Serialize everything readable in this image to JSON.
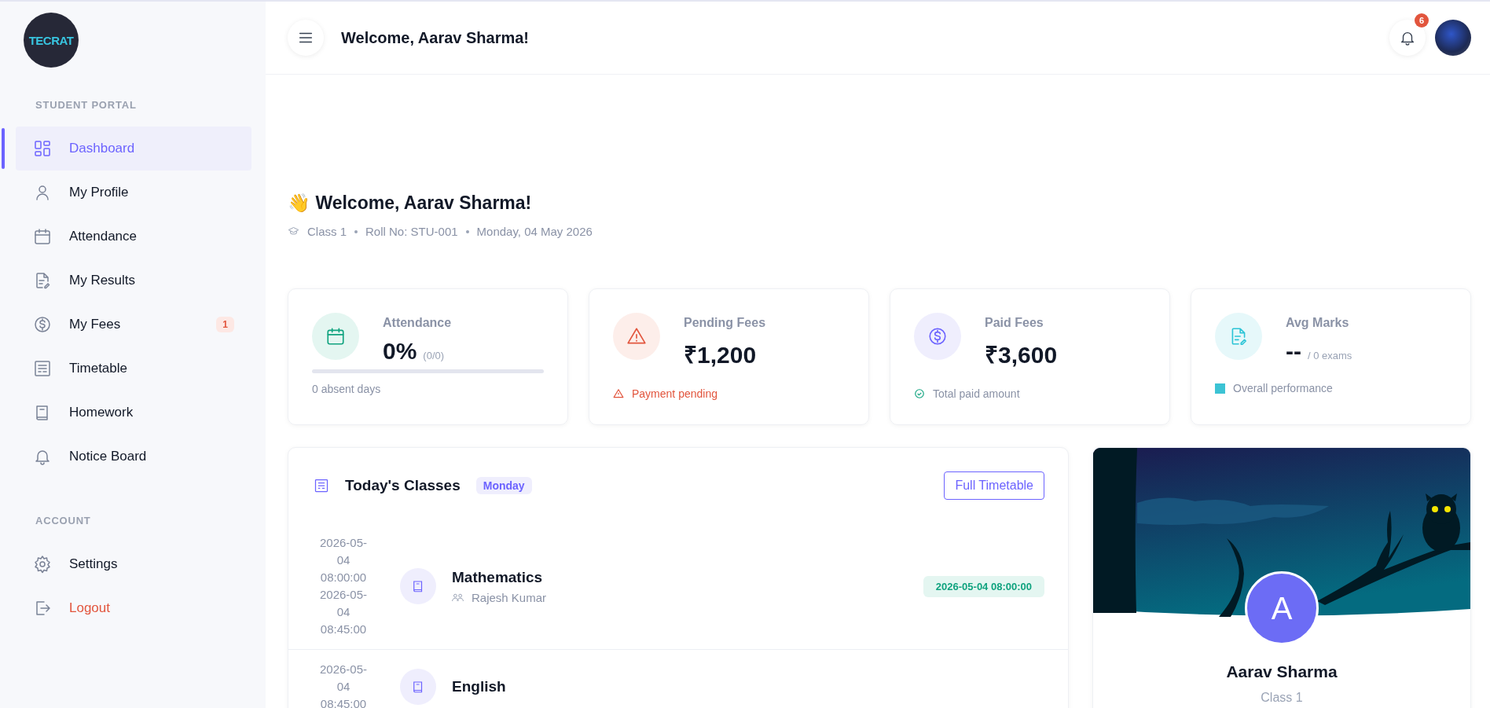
{
  "logo": {
    "text": "TECRAT"
  },
  "sidebar": {
    "sections": [
      {
        "title": "STUDENT PORTAL",
        "items": [
          {
            "label": "Dashboard",
            "kind": "grid",
            "selected": true
          },
          {
            "label": "My Profile",
            "kind": "user",
            "selected": false
          },
          {
            "label": "Attendance",
            "kind": "calendar",
            "selected": false
          },
          {
            "label": "My Results",
            "kind": "doc",
            "selected": false
          },
          {
            "label": "My Fees",
            "kind": "dollar",
            "selected": false,
            "badge": "1"
          },
          {
            "label": "Timetable",
            "kind": "table",
            "selected": false
          },
          {
            "label": "Homework",
            "kind": "book",
            "selected": false
          },
          {
            "label": "Notice Board",
            "kind": "bell",
            "selected": false
          }
        ]
      },
      {
        "title": "ACCOUNT",
        "items": [
          {
            "label": "Settings",
            "kind": "gear",
            "selected": false
          },
          {
            "label": "Logout",
            "kind": "logout",
            "selected": false,
            "danger": true
          }
        ]
      }
    ]
  },
  "header": {
    "title": "Welcome, Aarav Sharma!",
    "notifications": "6"
  },
  "welcome": {
    "emoji": "👋",
    "title": "Welcome, Aarav Sharma!",
    "meta": [
      "Class 1",
      "Roll No: STU-001",
      "Monday, 04 May 2026"
    ]
  },
  "stats": [
    {
      "kind": "attendance",
      "label": "Attendance",
      "value": "0%",
      "sub": "(0/0)",
      "level": 0,
      "footer": "0 absent days"
    },
    {
      "kind": "pending",
      "label": "Pending Fees",
      "value": "₹1,200",
      "footer": "Payment pending"
    },
    {
      "kind": "paid",
      "label": "Paid Fees",
      "value": "₹3,600",
      "footer": "Total paid amount"
    },
    {
      "kind": "marks",
      "label": "Avg Marks",
      "value": "--",
      "sub": "/ 0 exams",
      "footer": "Overall performance"
    }
  ],
  "classes": {
    "title": "Today's Classes",
    "day": "Monday",
    "button": "Full Timetable",
    "rows": [
      {
        "start": "2026-05-04 08:00:00",
        "end": "2026-05-04 08:45:00",
        "subject": "Mathematics",
        "teacher": "Rajesh Kumar",
        "badge": "2026-05-04 08:00:00"
      },
      {
        "start": "2026-05-04 08:45:00",
        "subject": "English"
      }
    ]
  },
  "profile": {
    "initial": "A",
    "name": "Aarav Sharma",
    "class": "Class 1"
  }
}
